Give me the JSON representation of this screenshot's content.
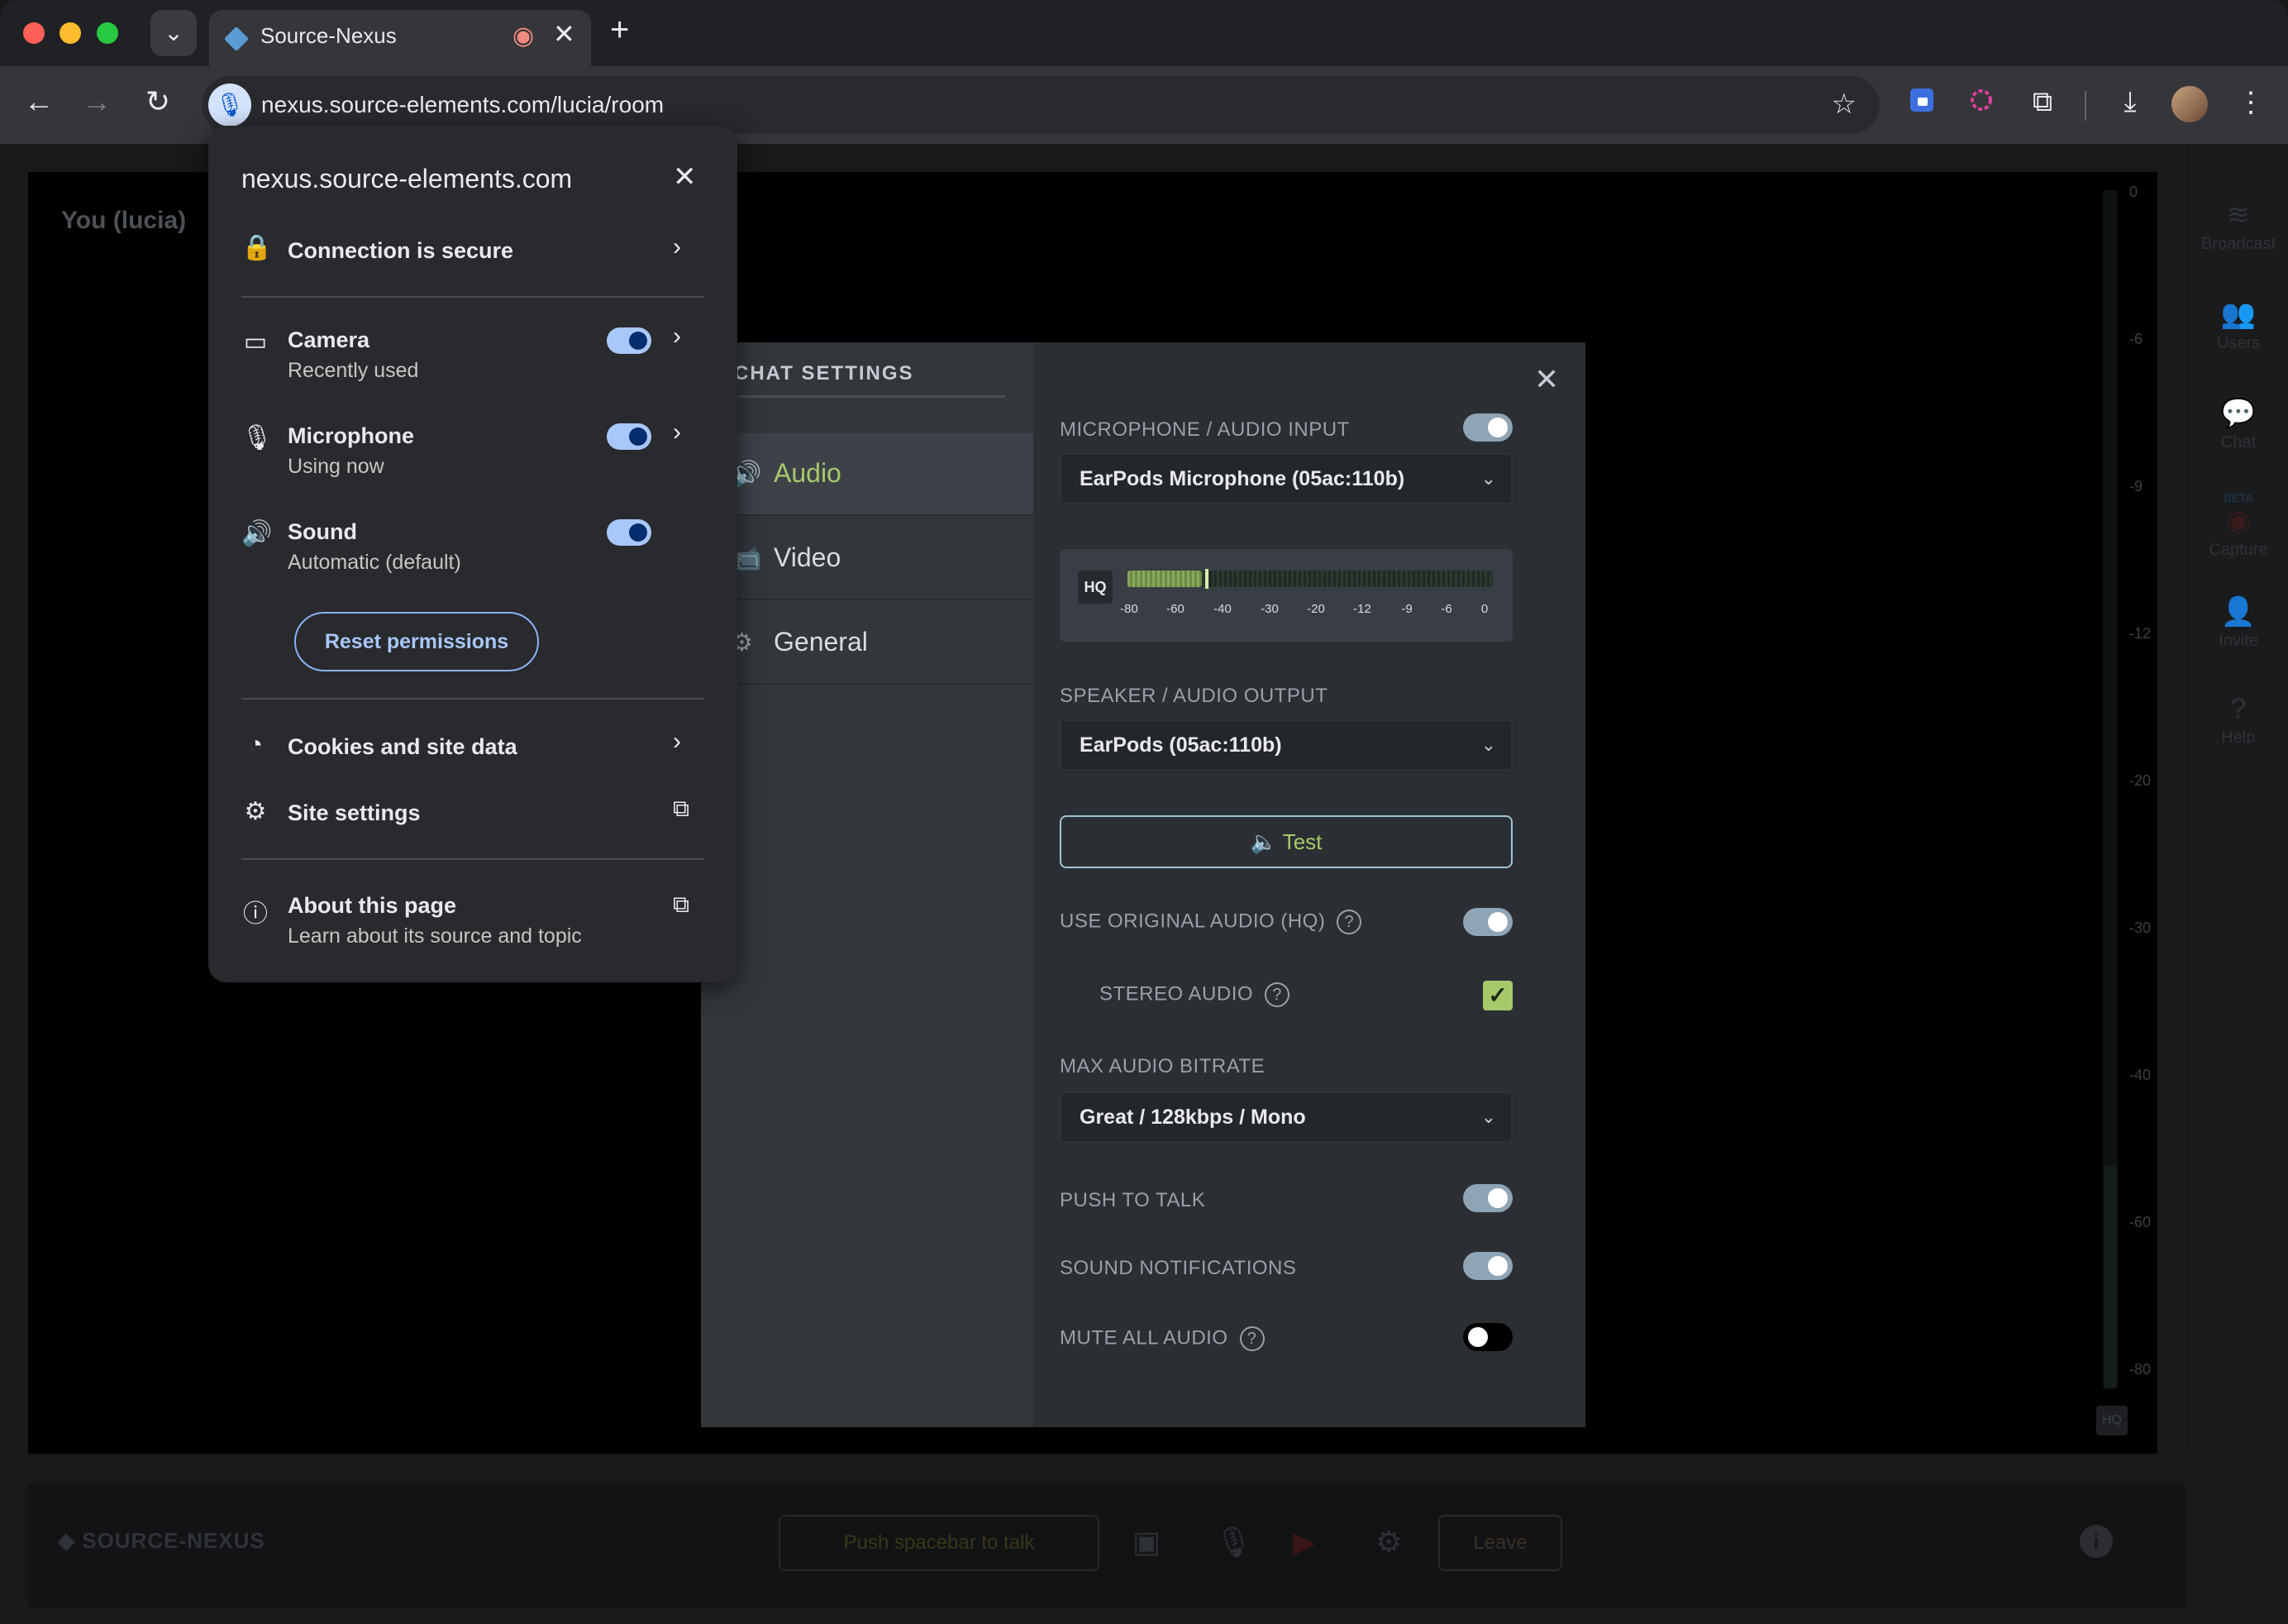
{
  "browser": {
    "tab_title": "Source-Nexus",
    "url": "nexus.source-elements.com/lucia/room",
    "icons": {
      "back": "←",
      "forward": "→",
      "reload": "↻",
      "star": "☆",
      "download": "⤓",
      "menu": "⋮",
      "puzzle": "⧉",
      "tablist": "⌄",
      "newtab": "+",
      "close": "✕",
      "record": "◉",
      "mic": "🎙"
    }
  },
  "site_popup": {
    "domain": "nexus.source-elements.com",
    "connection": "Connection is secure",
    "camera": {
      "title": "Camera",
      "sub": "Recently used"
    },
    "microphone": {
      "title": "Microphone",
      "sub": "Using now"
    },
    "sound": {
      "title": "Sound",
      "sub": "Automatic (default)"
    },
    "reset": "Reset permissions",
    "cookies": "Cookies and site data",
    "site_settings": "Site settings",
    "about": {
      "title": "About this page",
      "sub": "Learn about its source and topic"
    }
  },
  "room": {
    "self_label": "You (lucia)",
    "meter_labels": [
      "0",
      "-6",
      "-9",
      "-12",
      "-20",
      "-30",
      "-40",
      "-60",
      "-80"
    ],
    "meter_hq": "HQ",
    "right_sidebar": [
      {
        "label": "Broadcast",
        "icon": "≋"
      },
      {
        "label": "Users",
        "icon": "👥"
      },
      {
        "label": "Chat",
        "icon": "💬"
      },
      {
        "label": "Capture",
        "icon": "◉",
        "badge": "BETA"
      },
      {
        "label": "Invite",
        "icon": "👤"
      },
      {
        "label": "Help",
        "icon": "?"
      }
    ],
    "logo": "SOURCE-NEXUS",
    "push_to_talk": "Push spacebar to talk",
    "leave": "Leave",
    "info": "i"
  },
  "chat_settings": {
    "title": "CHAT SETTINGS",
    "menu": [
      {
        "label": "Audio",
        "icon": "🔊",
        "active": true
      },
      {
        "label": "Video",
        "icon": "📹",
        "active": false
      },
      {
        "label": "General",
        "icon": "⚙",
        "active": false
      }
    ],
    "mic_label": "MICROPHONE / AUDIO INPUT",
    "mic_device": "EarPods Microphone (05ac:110b)",
    "level_hq": "HQ",
    "level_ticks": [
      "-80",
      "-60",
      "-40",
      "-30",
      "-20",
      "-12",
      "-9",
      "-6",
      "0"
    ],
    "speaker_label": "SPEAKER / AUDIO OUTPUT",
    "speaker_device": "EarPods (05ac:110b)",
    "test": "🔈 Test",
    "original_audio": "USE ORIGINAL AUDIO (HQ)",
    "stereo": "STEREO AUDIO",
    "bitrate_label": "MAX AUDIO BITRATE",
    "bitrate": "Great / 128kbps / Mono",
    "push_to_talk": "PUSH TO TALK",
    "sound_notifications": "SOUND NOTIFICATIONS",
    "mute_all": "MUTE ALL AUDIO",
    "toggles": {
      "mic": true,
      "original_audio": true,
      "stereo": true,
      "push_to_talk": true,
      "sound_notifications": true,
      "mute_all": false
    },
    "help_glyph": "?",
    "check_glyph": "✓",
    "chevron": "⌄"
  }
}
